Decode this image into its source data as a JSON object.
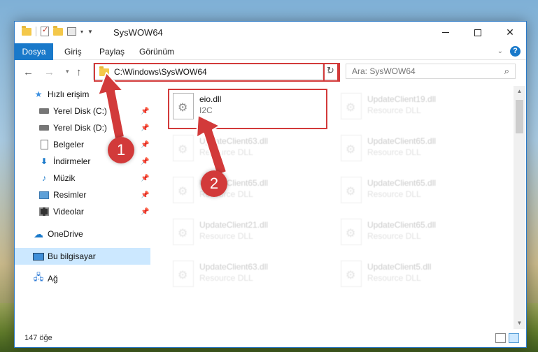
{
  "window": {
    "title": "SysWOW64"
  },
  "ribbon": {
    "tabs": [
      "Dosya",
      "Giriş",
      "Paylaş",
      "Görünüm"
    ],
    "help_label": "?"
  },
  "nav": {
    "address": "C:\\Windows\\SysWOW64",
    "search_placeholder": "Ara: SysWOW64"
  },
  "sidebar": {
    "items": [
      {
        "label": "Hızlı erişim",
        "icon": "star-icon"
      },
      {
        "label": "Yerel Disk (C:)",
        "icon": "drive-icon",
        "pinned": true
      },
      {
        "label": "Yerel Disk (D:)",
        "icon": "drive-icon",
        "pinned": true
      },
      {
        "label": "Belgeler",
        "icon": "documents-icon",
        "pinned": true
      },
      {
        "label": "İndirmeler",
        "icon": "downloads-icon",
        "pinned": true
      },
      {
        "label": "Müzik",
        "icon": "music-icon",
        "pinned": true
      },
      {
        "label": "Resimler",
        "icon": "pictures-icon",
        "pinned": true
      },
      {
        "label": "Videolar",
        "icon": "videos-icon",
        "pinned": true
      },
      {
        "label": "OneDrive",
        "icon": "onedrive-icon"
      },
      {
        "label": "Bu bilgisayar",
        "icon": "this-pc-icon",
        "selected": true
      },
      {
        "label": "Ağ",
        "icon": "network-icon"
      }
    ]
  },
  "files": [
    {
      "name": "eio.dll",
      "type": "I2C",
      "highlighted": true
    },
    {
      "name": "UpdateClient19.dll",
      "type": "Resource DLL"
    },
    {
      "name": "UpdateClient63.dll",
      "type": "Resource DLL"
    },
    {
      "name": "UpdateClient65.dll",
      "type": "Resource DLL"
    },
    {
      "name": "UpdateClient65.dll",
      "type": "Resource DLL"
    },
    {
      "name": "UpdateClient65.dll",
      "type": "Resource DLL"
    },
    {
      "name": "UpdateClient21.dll",
      "type": "Resource DLL"
    },
    {
      "name": "UpdateClient65.dll",
      "type": "Resource DLL"
    },
    {
      "name": "UpdateClient63.dll",
      "type": "Resource DLL"
    },
    {
      "name": "UpdateClient5.dll",
      "type": "Resource DLL"
    }
  ],
  "status": {
    "item_count": "147 öğe"
  },
  "annotations": {
    "badge1": "1",
    "badge2": "2",
    "color": "#d23a3a"
  },
  "colors": {
    "accent": "#1979ca",
    "selection": "#cce8ff"
  }
}
